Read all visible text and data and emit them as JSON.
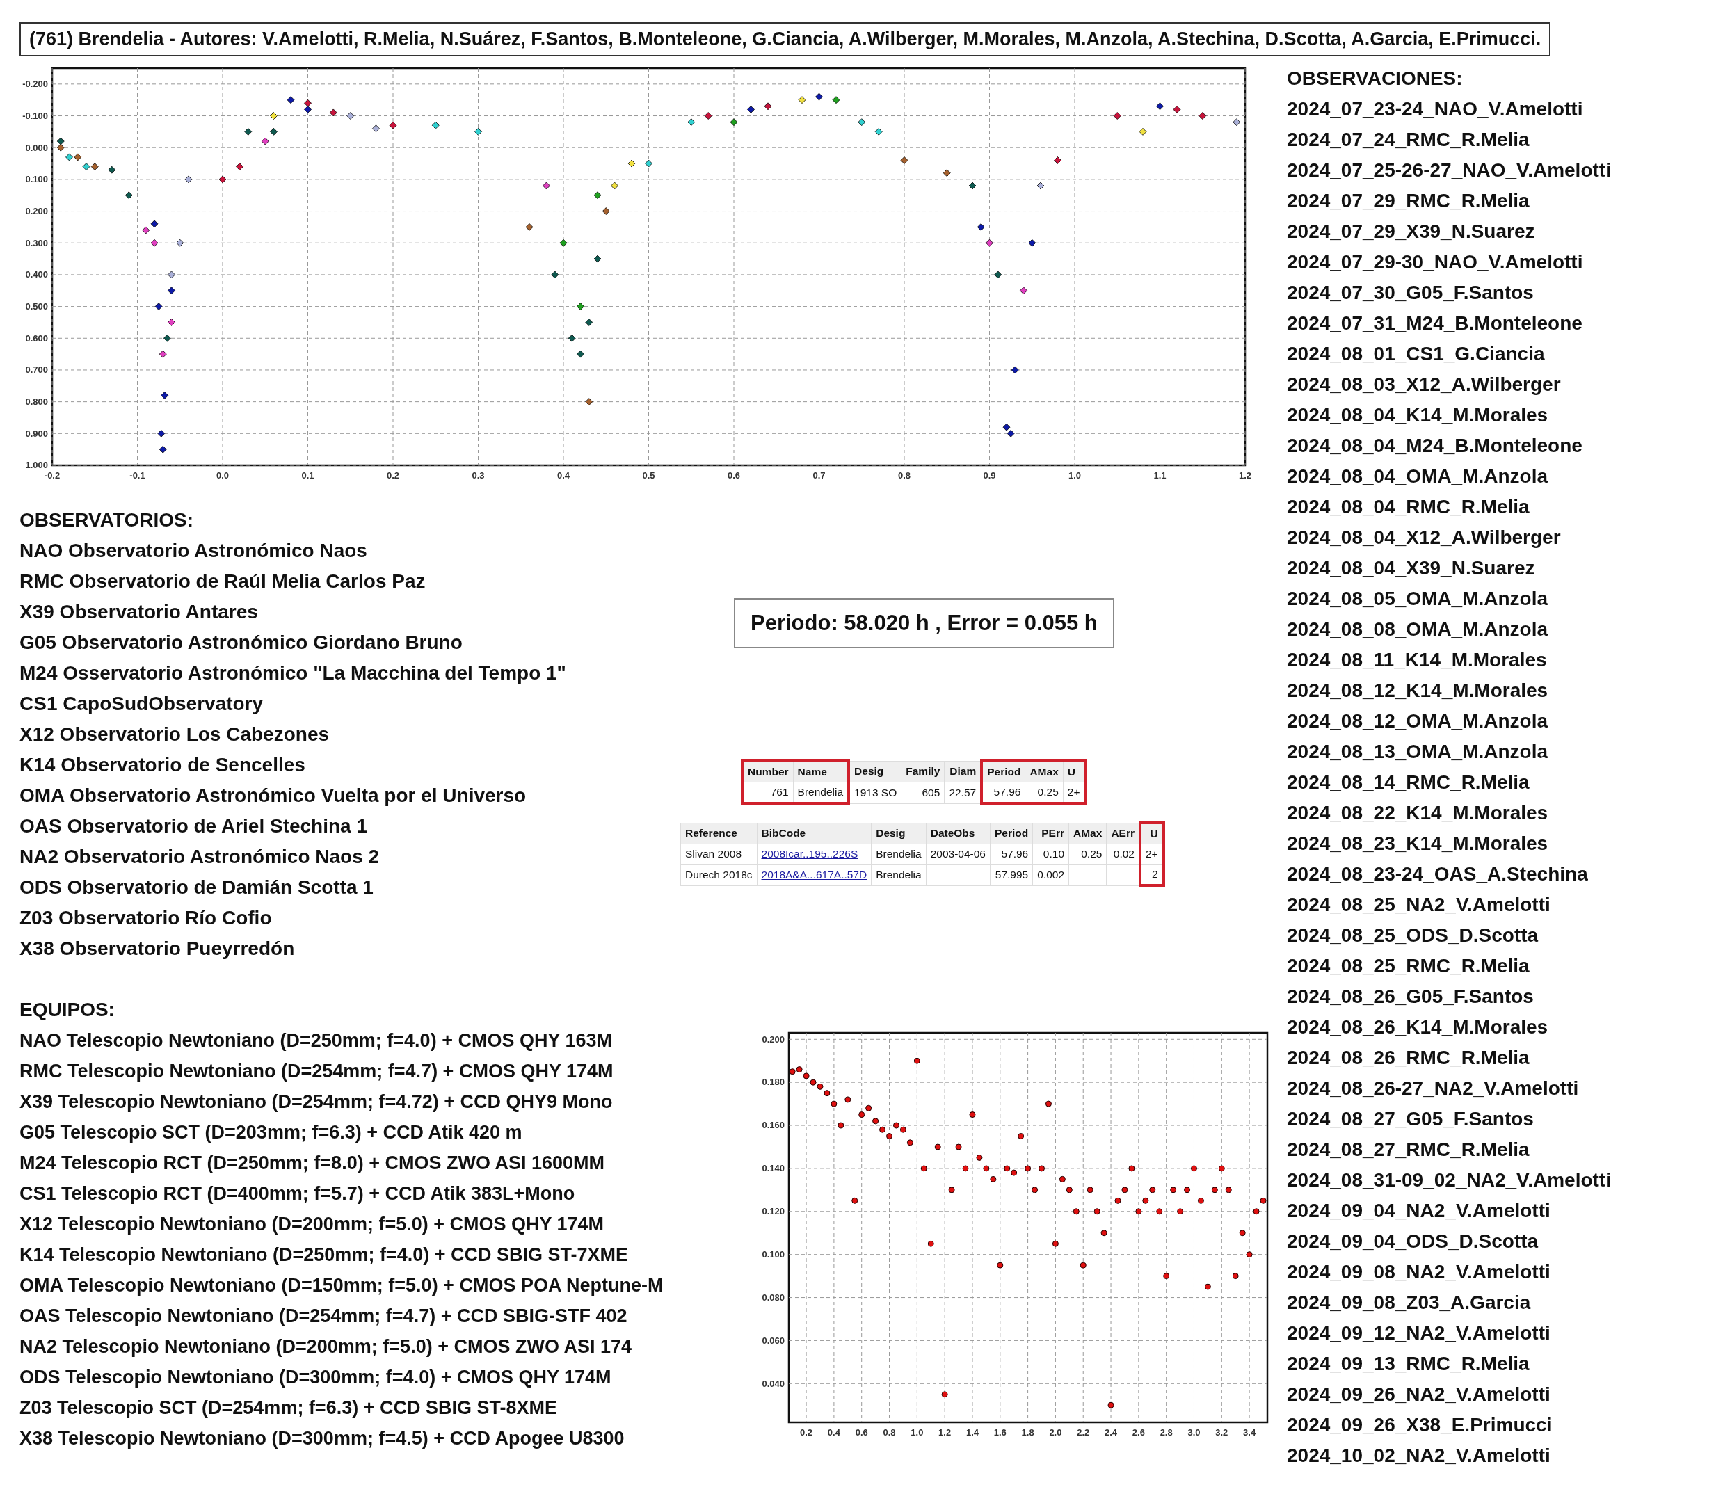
{
  "title": "(761) Brendelia - Autores: V.Amelotti, R.Melia, N.Suárez, F.Santos, B.Monteleone, G.Ciancia, A.Wilberger, M.Morales, M.Anzola, A.Stechina, D.Scotta, A.Garcia, E.Primucci.",
  "lightcurve": {
    "chart_data": {
      "type": "scatter",
      "grid": true,
      "xlim": [
        -0.2,
        1.2
      ],
      "ylim": [
        1.0,
        -0.25
      ],
      "xticks": [
        {
          "value": -0.2,
          "label": "-0.2"
        },
        {
          "value": -0.1,
          "label": "-0.1"
        },
        {
          "value": 0,
          "label": "0.0"
        },
        {
          "value": 0.1,
          "label": "0.1"
        },
        {
          "value": 0.2,
          "label": "0.2"
        },
        {
          "value": 0.3,
          "label": "0.3"
        },
        {
          "value": 0.4,
          "label": "0.4"
        },
        {
          "value": 0.5,
          "label": "0.5"
        },
        {
          "value": 0.6,
          "label": "0.6"
        },
        {
          "value": 0.7,
          "label": "0.7"
        },
        {
          "value": 0.8,
          "label": "0.8"
        },
        {
          "value": 0.9,
          "label": "0.9"
        },
        {
          "value": 1.0,
          "label": "1.0"
        },
        {
          "value": 1.1,
          "label": "1.1"
        },
        {
          "value": 1.2,
          "label": "1.2"
        }
      ],
      "yticks": [
        {
          "value": -0.2,
          "label": "-0.200"
        },
        {
          "value": -0.1,
          "label": "-0.100"
        },
        {
          "value": 0,
          "label": "0.000"
        },
        {
          "value": 0.1,
          "label": "0.100"
        },
        {
          "value": 0.2,
          "label": "0.200"
        },
        {
          "value": 0.3,
          "label": "0.300"
        },
        {
          "value": 0.4,
          "label": "0.400"
        },
        {
          "value": 0.5,
          "label": "0.500"
        },
        {
          "value": 0.6,
          "label": "0.600"
        },
        {
          "value": 0.7,
          "label": "0.700"
        },
        {
          "value": 0.8,
          "label": "0.800"
        },
        {
          "value": 0.9,
          "label": "0.900"
        },
        {
          "value": 1.0,
          "label": "1.000"
        }
      ],
      "series": [
        {
          "color": "#0d1aa8",
          "x": [
            -0.08,
            -0.075,
            -0.072,
            -0.07,
            -0.068,
            -0.06,
            0.08,
            0.1,
            0.62,
            0.7,
            0.89,
            0.92,
            0.925,
            0.93,
            0.95,
            1.1
          ],
          "values": [
            0.24,
            0.5,
            0.9,
            0.95,
            0.78,
            0.45,
            -0.15,
            -0.12,
            -0.12,
            -0.16,
            0.25,
            0.88,
            0.9,
            0.7,
            0.3,
            -0.13
          ]
        },
        {
          "color": "#c8143c",
          "x": [
            0.0,
            0.02,
            0.1,
            0.13,
            0.2,
            0.57,
            0.64,
            0.98,
            1.05,
            1.12,
            1.15
          ],
          "values": [
            0.1,
            0.06,
            -0.14,
            -0.11,
            -0.07,
            -0.1,
            -0.13,
            0.04,
            -0.1,
            -0.12,
            -0.1
          ]
        },
        {
          "color": "#0f5a50",
          "x": [
            -0.13,
            -0.11,
            -0.065,
            0.03,
            0.06,
            0.39,
            0.41,
            0.42,
            0.43,
            0.44,
            0.88,
            0.91,
            -0.19
          ],
          "values": [
            0.07,
            0.15,
            0.6,
            -0.05,
            -0.05,
            0.4,
            0.6,
            0.65,
            0.55,
            0.35,
            0.12,
            0.4,
            -0.02
          ]
        },
        {
          "color": "#a5612e",
          "x": [
            -0.19,
            -0.17,
            -0.15,
            0.36,
            0.43,
            0.8,
            0.85,
            0.45
          ],
          "values": [
            0.0,
            0.03,
            0.06,
            0.25,
            0.8,
            0.04,
            0.08,
            0.2
          ]
        },
        {
          "color": "#e040c0",
          "x": [
            -0.09,
            -0.08,
            -0.07,
            -0.06,
            0.05,
            0.38,
            0.9,
            0.94
          ],
          "values": [
            0.26,
            0.3,
            0.65,
            0.55,
            -0.02,
            0.12,
            0.3,
            0.45
          ]
        },
        {
          "color": "#30d0d0",
          "x": [
            -0.18,
            -0.16,
            0.25,
            0.3,
            0.55,
            0.5,
            0.75,
            0.77
          ],
          "values": [
            0.03,
            0.06,
            -0.07,
            -0.05,
            -0.08,
            0.05,
            -0.08,
            -0.05
          ]
        },
        {
          "color": "#aab0d8",
          "x": [
            -0.04,
            -0.05,
            -0.06,
            0.15,
            0.18,
            0.96,
            1.19
          ],
          "values": [
            0.1,
            0.3,
            0.4,
            -0.1,
            -0.06,
            0.12,
            -0.08
          ]
        },
        {
          "color": "#f0e040",
          "x": [
            0.06,
            0.46,
            0.48,
            1.08,
            0.68
          ],
          "values": [
            -0.1,
            0.12,
            0.05,
            -0.05,
            -0.15
          ]
        },
        {
          "color": "#20a020",
          "x": [
            0.4,
            0.42,
            0.44,
            0.6,
            0.72
          ],
          "values": [
            0.3,
            0.5,
            0.15,
            -0.08,
            -0.15
          ]
        }
      ]
    }
  },
  "observatories": {
    "heading": "OBSERVATORIOS:",
    "items": [
      "NAO Observatorio Astronómico Naos",
      "RMC Observatorio de Raúl Melia Carlos Paz",
      "X39 Observatorio Antares",
      "G05 Observatorio Astronómico Giordano Bruno",
      "M24 Osservatorio Astronómico \"La Macchina del Tempo 1\"",
      "CS1 CapoSudObservatory",
      "X12 Observatorio Los Cabezones",
      "K14 Observatorio de Sencelles",
      "OMA Observatorio Astronómico Vuelta por el Universo",
      "OAS Observatorio de Ariel Stechina 1",
      "NA2 Observatorio Astronómico Naos 2",
      "ODS Observatorio de Damián Scotta 1",
      "Z03 Observatorio Río Cofio",
      "X38 Observatorio Pueyrredón"
    ]
  },
  "equipment": {
    "heading": "EQUIPOS:",
    "items": [
      "NAO Telescopio Newtoniano (D=250mm; f=4.0) + CMOS QHY 163M",
      "RMC Telescopio Newtoniano (D=254mm; f=4.7) + CMOS QHY 174M",
      "X39 Telescopio Newtoniano (D=254mm; f=4.72) + CCD QHY9 Mono",
      "G05 Telescopio SCT (D=203mm; f=6.3) + CCD Atik 420 m",
      "M24 Telescopio RCT (D=250mm; f=8.0) + CMOS ZWO ASI 1600MM",
      "CS1 Telescopio RCT (D=400mm; f=5.7) + CCD Atik 383L+Mono",
      "X12 Telescopio Newtoniano (D=200mm; f=5.0) + CMOS QHY 174M",
      "K14 Telescopio Newtoniano (D=250mm; f=4.0) + CCD SBIG ST-7XME",
      "OMA Telescopio Newtoniano (D=150mm; f=5.0) + CMOS POA Neptune-M",
      "OAS Telescopio Newtoniano (D=254mm; f=4.7) + CCD SBIG-STF 402",
      "NA2 Telescopio Newtoniano (D=200mm; f=5.0) + CMOS ZWO ASI 174",
      "ODS Telescopio Newtoniano (D=300mm; f=4.0) + CMOS QHY 174M",
      "Z03 Telescopio SCT (D=254mm; f=6.3) + CCD SBIG ST-8XME",
      "X38 Telescopio Newtoniano (D=300mm; f=4.5) + CCD Apogee U8300"
    ]
  },
  "period": "Periodo: 58.020 h , Error = 0.055 h",
  "tables": [
    {
      "columns": [
        {
          "label": "Number",
          "kind": "number",
          "highlighted": true
        },
        {
          "label": "Name",
          "kind": "text",
          "highlighted": true
        },
        {
          "label": "Desig",
          "kind": "text",
          "highlighted": false
        },
        {
          "label": "Family",
          "kind": "number",
          "highlighted": false
        },
        {
          "label": "Diam",
          "kind": "number",
          "highlighted": false
        },
        {
          "label": "Period",
          "kind": "number",
          "highlighted": true
        },
        {
          "label": "AMax",
          "kind": "number",
          "highlighted": true
        },
        {
          "label": "U",
          "kind": "text",
          "highlighted": true
        }
      ],
      "rows": [
        [
          "761",
          "Brendelia",
          "1913 SO",
          "605",
          "22.57",
          "57.96",
          "0.25",
          "2+"
        ]
      ]
    },
    {
      "columns": [
        {
          "label": "Reference",
          "kind": "text",
          "highlighted": false
        },
        {
          "label": "BibCode",
          "kind": "link",
          "highlighted": false
        },
        {
          "label": "Desig",
          "kind": "text",
          "highlighted": false
        },
        {
          "label": "DateObs",
          "kind": "text",
          "highlighted": false
        },
        {
          "label": "Period",
          "kind": "number",
          "highlighted": false
        },
        {
          "label": "PErr",
          "kind": "number",
          "highlighted": false
        },
        {
          "label": "AMax",
          "kind": "number",
          "highlighted": false
        },
        {
          "label": "AErr",
          "kind": "number",
          "highlighted": false
        },
        {
          "label": "U",
          "kind": "number",
          "highlighted": true
        }
      ],
      "rows": [
        [
          "Slivan 2008",
          "2008Icar..195..226S",
          "Brendelia",
          "2003-04-06",
          "57.96",
          "0.10",
          "0.25",
          "0.02",
          "2+"
        ],
        [
          "Durech 2018c",
          "2018A&A...617A..57D",
          "Brendelia",
          null,
          "57.995",
          "0.002",
          null,
          null,
          "2"
        ]
      ]
    }
  ],
  "periodogram": {
    "chart_data": {
      "type": "scatter",
      "grid": true,
      "xlim": [
        0.074,
        3.53
      ],
      "ylim": [
        0.022,
        0.203
      ],
      "xticks": [
        {
          "value": 0.2,
          "label": "0.2"
        },
        {
          "value": 0.4,
          "label": "0.4"
        },
        {
          "value": 0.6,
          "label": "0.6"
        },
        {
          "value": 0.8,
          "label": "0.8"
        },
        {
          "value": 1.0,
          "label": "1.0"
        },
        {
          "value": 1.2,
          "label": "1.2"
        },
        {
          "value": 1.4,
          "label": "1.4"
        },
        {
          "value": 1.6,
          "label": "1.6"
        },
        {
          "value": 1.8,
          "label": "1.8"
        },
        {
          "value": 2.0,
          "label": "2.0"
        },
        {
          "value": 2.2,
          "label": "2.2"
        },
        {
          "value": 2.4,
          "label": "2.4"
        },
        {
          "value": 2.6,
          "label": "2.6"
        },
        {
          "value": 2.8,
          "label": "2.8"
        },
        {
          "value": 3.0,
          "label": "3.0"
        },
        {
          "value": 3.2,
          "label": "3.2"
        },
        {
          "value": 3.4,
          "label": "3.4"
        }
      ],
      "yticks": [
        {
          "value": 0.04,
          "label": "0.040"
        },
        {
          "value": 0.06,
          "label": "0.060"
        },
        {
          "value": 0.08,
          "label": "0.080"
        },
        {
          "value": 0.1,
          "label": "0.100"
        },
        {
          "value": 0.12,
          "label": "0.120"
        },
        {
          "value": 0.14,
          "label": "0.140"
        },
        {
          "value": 0.16,
          "label": "0.160"
        },
        {
          "value": 0.18,
          "label": "0.180"
        },
        {
          "value": 0.2,
          "label": "0.200"
        }
      ],
      "series": [
        {
          "color": "#e01010",
          "x": [
            0.1,
            0.15,
            0.2,
            0.25,
            0.3,
            0.35,
            0.4,
            0.45,
            0.5,
            0.55,
            0.6,
            0.65,
            0.7,
            0.75,
            0.8,
            0.85,
            0.9,
            0.95,
            1.0,
            1.05,
            1.1,
            1.15,
            1.2,
            1.25,
            1.3,
            1.35,
            1.4,
            1.45,
            1.5,
            1.55,
            1.6,
            1.65,
            1.7,
            1.75,
            1.8,
            1.85,
            1.9,
            1.95,
            2.0,
            2.05,
            2.1,
            2.15,
            2.2,
            2.25,
            2.3,
            2.35,
            2.4,
            2.45,
            2.5,
            2.55,
            2.6,
            2.65,
            2.7,
            2.75,
            2.8,
            2.85,
            2.9,
            2.95,
            3.0,
            3.05,
            3.1,
            3.15,
            3.2,
            3.25,
            3.3,
            3.35,
            3.4,
            3.45,
            3.5
          ],
          "values": [
            0.185,
            0.186,
            0.183,
            0.18,
            0.178,
            0.175,
            0.17,
            0.16,
            0.172,
            0.125,
            0.165,
            0.168,
            0.162,
            0.158,
            0.155,
            0.16,
            0.158,
            0.152,
            0.19,
            0.14,
            0.105,
            0.15,
            0.035,
            0.13,
            0.15,
            0.14,
            0.165,
            0.145,
            0.14,
            0.135,
            0.095,
            0.14,
            0.138,
            0.155,
            0.14,
            0.13,
            0.14,
            0.17,
            0.105,
            0.135,
            0.13,
            0.12,
            0.095,
            0.13,
            0.12,
            0.11,
            0.03,
            0.125,
            0.13,
            0.14,
            0.12,
            0.125,
            0.13,
            0.12,
            0.09,
            0.13,
            0.12,
            0.13,
            0.14,
            0.125,
            0.085,
            0.13,
            0.14,
            0.13,
            0.09,
            0.11,
            0.1,
            0.12,
            0.125
          ]
        }
      ]
    }
  },
  "observations": {
    "heading": "OBSERVACIONES:",
    "items": [
      "2024_07_23-24_NAO_V.Amelotti",
      "2024_07_24_RMC_R.Melia",
      "2024_07_25-26-27_NAO_V.Amelotti",
      "2024_07_29_RMC_R.Melia",
      "2024_07_29_X39_N.Suarez",
      "2024_07_29-30_NAO_V.Amelotti",
      "2024_07_30_G05_F.Santos",
      "2024_07_31_M24_B.Monteleone",
      "2024_08_01_CS1_G.Ciancia",
      "2024_08_03_X12_A.Wilberger",
      "2024_08_04_K14_M.Morales",
      "2024_08_04_M24_B.Monteleone",
      "2024_08_04_OMA_M.Anzola",
      "2024_08_04_RMC_R.Melia",
      "2024_08_04_X12_A.Wilberger",
      "2024_08_04_X39_N.Suarez",
      "2024_08_05_OMA_M.Anzola",
      "2024_08_08_OMA_M.Anzola",
      "2024_08_11_K14_M.Morales",
      "2024_08_12_K14_M.Morales",
      "2024_08_12_OMA_M.Anzola",
      "2024_08_13_OMA_M.Anzola",
      "2024_08_14_RMC_R.Melia",
      "2024_08_22_K14_M.Morales",
      "2024_08_23_K14_M.Morales",
      "2024_08_23-24_OAS_A.Stechina",
      "2024_08_25_NA2_V.Amelotti",
      "2024_08_25_ODS_D.Scotta",
      "2024_08_25_RMC_R.Melia",
      "2024_08_26_G05_F.Santos",
      "2024_08_26_K14_M.Morales",
      "2024_08_26_RMC_R.Melia",
      "2024_08_26-27_NA2_V.Amelotti",
      "2024_08_27_G05_F.Santos",
      "2024_08_27_RMC_R.Melia",
      "2024_08_31-09_02_NA2_V.Amelotti",
      "2024_09_04_NA2_V.Amelotti",
      "2024_09_04_ODS_D.Scotta",
      "2024_09_08_NA2_V.Amelotti",
      "2024_09_08_Z03_A.Garcia",
      "2024_09_12_NA2_V.Amelotti",
      "2024_09_13_RMC_R.Melia",
      "2024_09_26_NA2_V.Amelotti",
      "2024_09_26_X38_E.Primucci",
      "2024_10_02_NA2_V.Amelotti"
    ]
  }
}
